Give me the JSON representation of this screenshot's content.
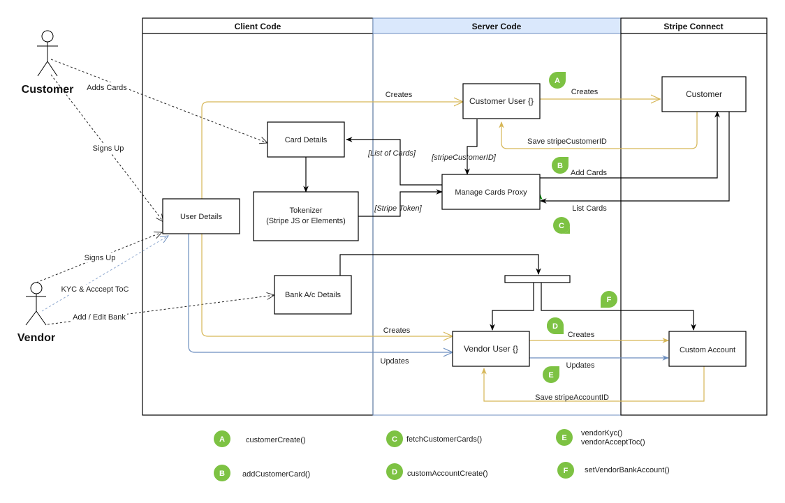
{
  "colors": {
    "gold": "#d6b656",
    "blue": "#6c8ebf",
    "lane_header_blue": "#dae8fc",
    "badge_green": "#7dc243",
    "green_arrow": "#009900",
    "black": "#000000"
  },
  "actors": {
    "customer": "Customer",
    "vendor": "Vendor"
  },
  "lanes": {
    "client": "Client Code",
    "server": "Server Code",
    "stripe": "Stripe Connect"
  },
  "boxes": {
    "card_details": "Card Details",
    "tokenizer_line1": "Tokenizer",
    "tokenizer_line2": "(Stripe JS or Elements)",
    "user_details": "User Details",
    "bank_details": "Bank A/c Details",
    "customer_user": "Customer User {}",
    "manage_cards_proxy": "Manage Cards Proxy",
    "vendor_user": "Vendor User {}",
    "customer": "Customer",
    "custom_account": "Custom Account"
  },
  "edges": {
    "adds_cards": "Adds Cards",
    "customer_signs_up": "Signs Up",
    "vendor_signs_up": "Signs Up",
    "kyc_accept_toc": "KYC & Acccept ToC",
    "add_edit_bank": "Add / Edit Bank",
    "creates_customer_user": "Creates",
    "creates_customer": "Creates",
    "save_stripe_customer_id": "Save stripeCustomerID",
    "list_of_cards": "[List of Cards]",
    "stripe_customer_id": "[stripeCustomerID]",
    "stripe_token": "[Stripe  Token]",
    "add_cards": "Add Cards",
    "list_cards": "List Cards",
    "creates_vendor_user": "Creates",
    "updates_vendor_user": "Updates",
    "creates_custom_account": "Creates",
    "updates_custom_account": "Updates",
    "save_stripe_account_id": "Save stripeAccountID"
  },
  "badges": {
    "a": "A",
    "b": "B",
    "c": "C",
    "d": "D",
    "e": "E",
    "f": "F"
  },
  "legend": [
    {
      "badge": "A",
      "text": "customerCreate()"
    },
    {
      "badge": "B",
      "text": "addCustomerCard()"
    },
    {
      "badge": "C",
      "text": "fetchCustomerCards()"
    },
    {
      "badge": "D",
      "text": "customAccountCreate()"
    },
    {
      "badge": "E",
      "text": "vendorKyc()",
      "text2": "vendorAcceptToc()"
    },
    {
      "badge": "F",
      "text": "setVendorBankAccount()"
    }
  ]
}
